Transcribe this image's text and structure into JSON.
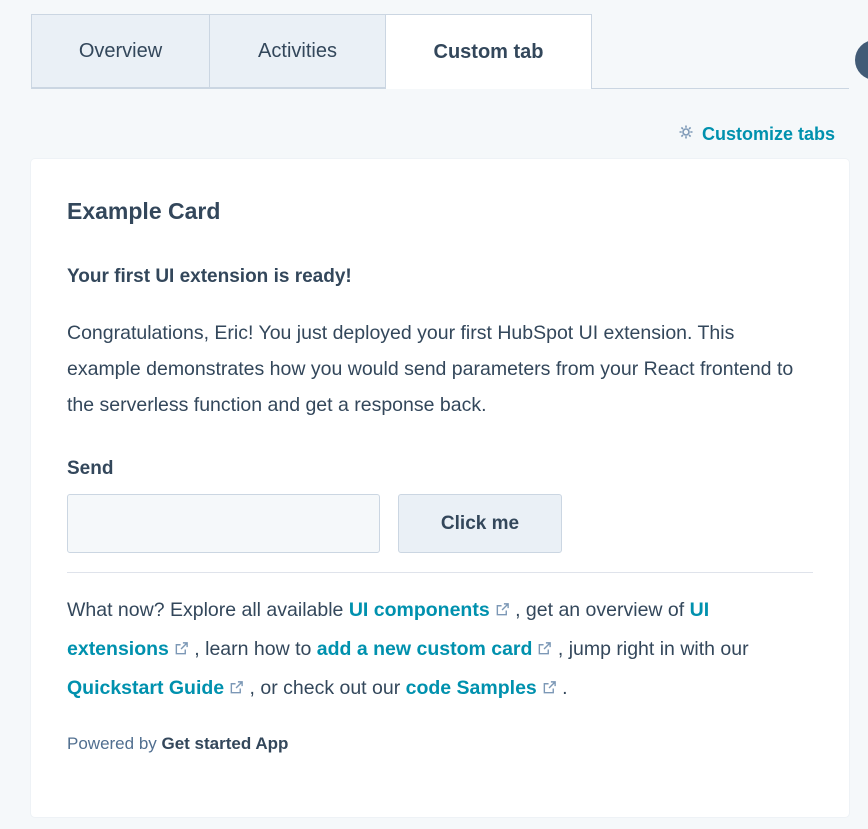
{
  "tabs": [
    {
      "label": "Overview",
      "active": false
    },
    {
      "label": "Activities",
      "active": false
    },
    {
      "label": "Custom tab",
      "active": true
    }
  ],
  "customize": {
    "label": "Customize tabs",
    "icon": "gear-icon"
  },
  "card": {
    "title": "Example Card",
    "subtitle": "Your first UI extension is ready!",
    "paragraph": "Congratulations, Eric! You just deployed your first HubSpot UI extension. This example demonstrates how you would send parameters from your React frontend to the serverless function and get a response back.",
    "send_label": "Send",
    "send_input_value": "",
    "button_label": "Click me",
    "whatnow": {
      "t1": "What now? Explore all available ",
      "l1": "UI components",
      "t2": " , get an overview of ",
      "l2": "UI extensions",
      "t3": " , learn how to ",
      "l3": "add a new custom card",
      "t4": " , jump right in with our ",
      "l4": "Quickstart Guide",
      "t5": " , or check out our ",
      "l5": "code Samples",
      "t6": " ."
    },
    "powered_prefix": "Powered by ",
    "powered_app": "Get started App"
  },
  "colors": {
    "accent": "#0091ae",
    "text": "#33475b",
    "tab_bg": "#eaf0f6",
    "page_bg": "#f5f8fa"
  }
}
